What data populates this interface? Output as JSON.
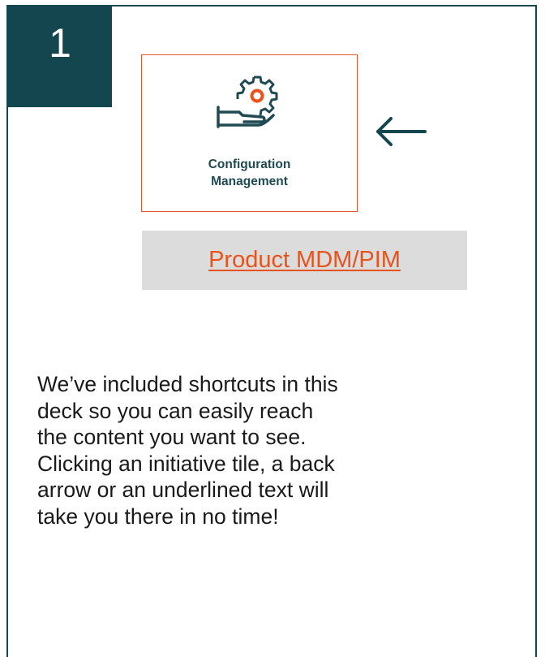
{
  "step": {
    "number": "1"
  },
  "tile": {
    "label_line1": "Configuration",
    "label_line2": "Management",
    "icon": "gear-in-hand-icon",
    "border_color": "#e4572a",
    "icon_color": "#1f4a52",
    "gear_center_color": "#e8531b"
  },
  "back_arrow": {
    "icon": "arrow-left-icon",
    "color": "#144650"
  },
  "link": {
    "label": "Product MDM/PIM",
    "color": "#e8531b",
    "background": "#dcdcdc"
  },
  "description": {
    "lines": [
      "We’ve included shortcuts in this",
      "deck so you can easily reach",
      "the content you want to see.",
      "Clicking an initiative tile, a back",
      "arrow or an underlined text will",
      "take you there in no time!"
    ]
  },
  "colors": {
    "primary": "#144650",
    "accent": "#e8531b"
  }
}
